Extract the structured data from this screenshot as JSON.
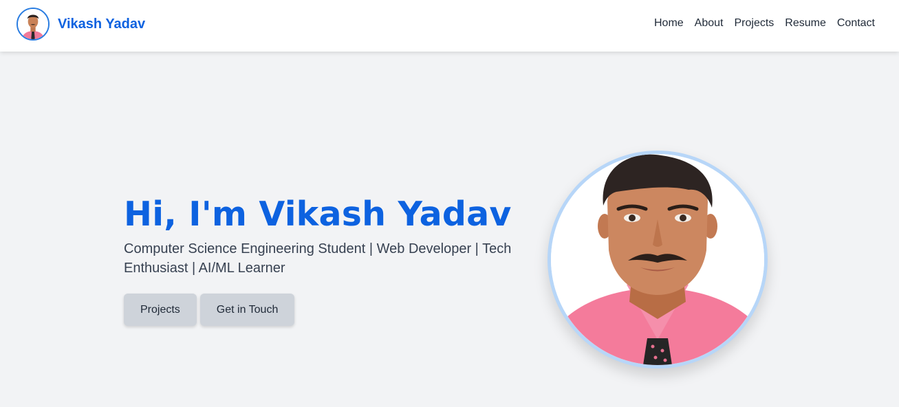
{
  "header": {
    "brand_name": "Vikash Yadav",
    "nav": [
      {
        "label": "Home"
      },
      {
        "label": "About"
      },
      {
        "label": "Projects"
      },
      {
        "label": "Resume"
      },
      {
        "label": "Contact"
      }
    ]
  },
  "hero": {
    "title": "Hi, I'm Vikash Yadav",
    "subtitle": "Computer Science Engineering Student | Web Developer | Tech Enthusiast | AI/ML Learner",
    "buttons": {
      "projects_label": "Projects",
      "contact_label": "Get in Touch"
    }
  },
  "colors": {
    "accent": "#0d62e0",
    "background": "#f2f3f5",
    "button_bg": "#ced3da"
  },
  "icons": {
    "brand_avatar": "profile-photo",
    "hero_photo": "profile-photo"
  }
}
